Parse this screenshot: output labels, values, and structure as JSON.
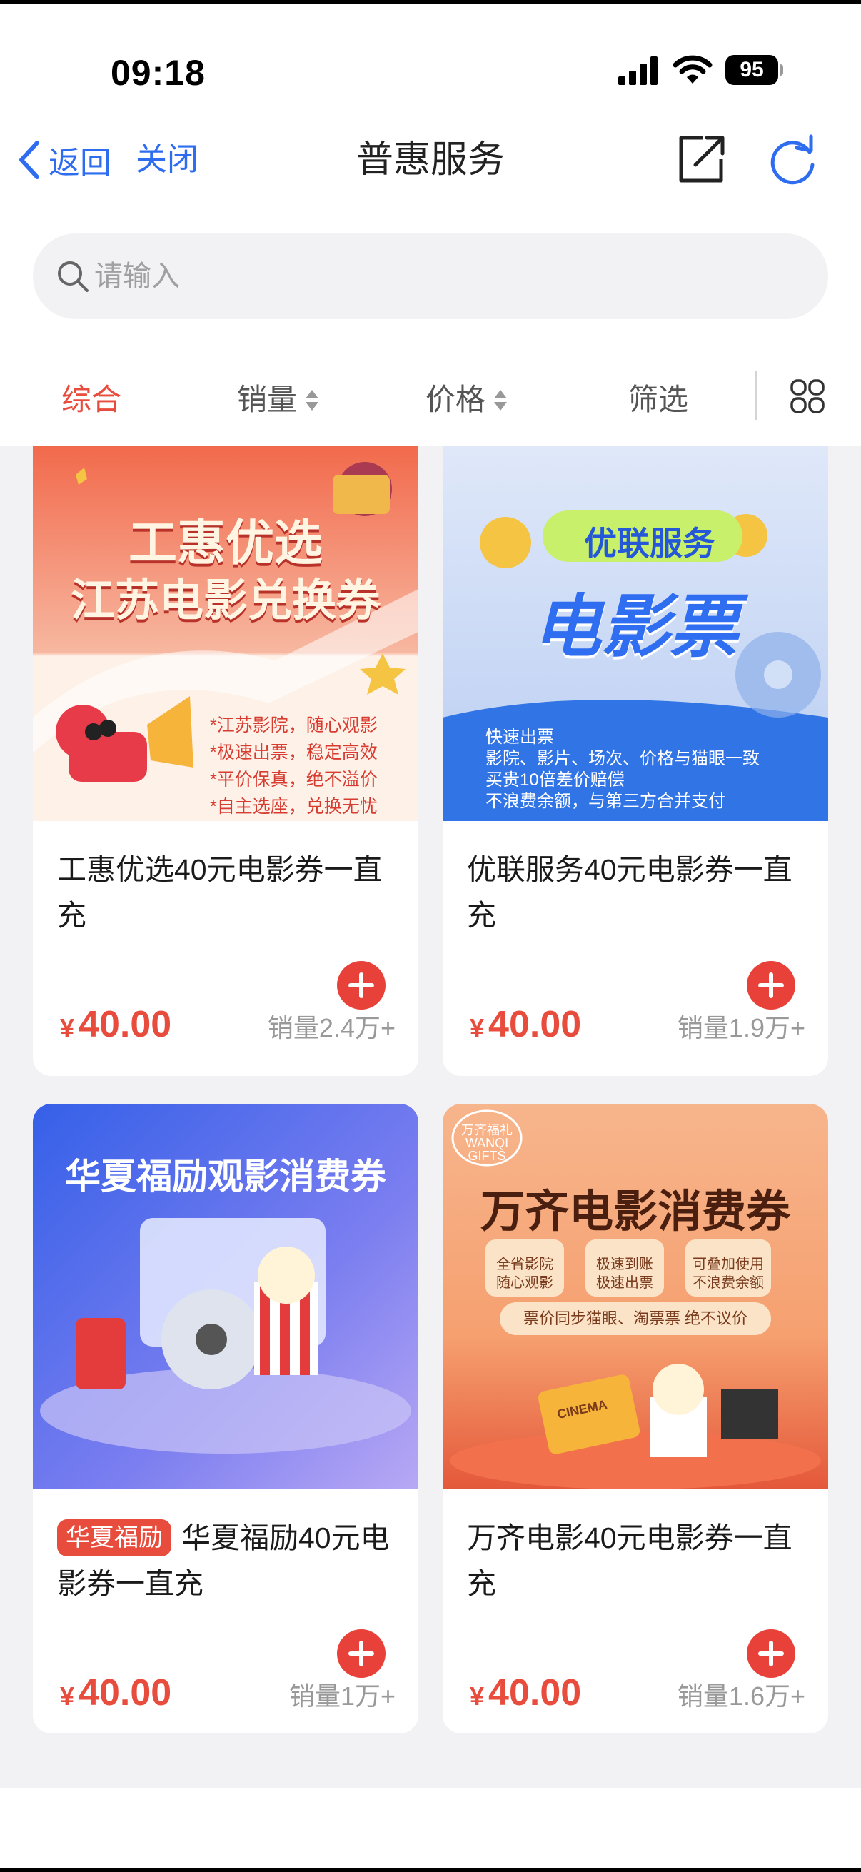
{
  "status_bar": {
    "time": "09:18",
    "battery": "95"
  },
  "nav": {
    "back_label": "返回",
    "close_label": "关闭",
    "title": "普惠服务"
  },
  "search": {
    "placeholder": "请输入"
  },
  "sort_tabs": [
    {
      "label": "综合",
      "active": true
    },
    {
      "label": "销量",
      "active": false
    },
    {
      "label": "价格",
      "active": false
    },
    {
      "label": "筛选",
      "active": false
    }
  ],
  "products": [
    {
      "title": "工惠优选40元电影券一直充",
      "currency": "¥",
      "price": "40.00",
      "sales": "销量2.4万+",
      "banner": {
        "headline_1": "工惠优选",
        "headline_2": "江苏电影兑换券",
        "bullets": [
          "*江苏影院，随心观影",
          "*极速出票，稳定高效",
          "*平价保真，绝不溢价",
          "*自主选座，兑换无忧"
        ]
      }
    },
    {
      "title": "优联服务40元电影券一直充",
      "currency": "¥",
      "price": "40.00",
      "sales": "销量1.9万+",
      "banner": {
        "headline_1": "优联服务",
        "headline_2": "电影票",
        "bullets": [
          "快速出票",
          "影院、影片、场次、价格与猫眼一致",
          "买贵10倍差价赔偿",
          "不浪费余额，与第三方合并支付"
        ]
      }
    },
    {
      "tag": "华夏福励",
      "title": "华夏福励40元电影券一直充",
      "currency": "¥",
      "price": "40.00",
      "sales": "销量1万+",
      "banner": {
        "headline_1": "华夏福励观影消费券"
      }
    },
    {
      "title": "万齐电影40元电影券一直充",
      "currency": "¥",
      "price": "40.00",
      "sales": "销量1.6万+",
      "banner": {
        "logo": "万齐福礼 WANQI GIFTS",
        "headline_1": "万齐电影消费券",
        "features": [
          "全省影院\n随心观影",
          "极速到账\n极速出票",
          "可叠加使用\n不浪费余额"
        ],
        "note": "票价同步猫眼、淘票票 绝不议价",
        "ticket_text": "CINEMA"
      }
    }
  ],
  "colors": {
    "accent": "#e84c3d",
    "link": "#2e6cf0"
  },
  "icons": [
    "back-chevron-icon",
    "share-icon",
    "refresh-icon",
    "search-icon",
    "grid-view-icon",
    "plus-icon"
  ]
}
